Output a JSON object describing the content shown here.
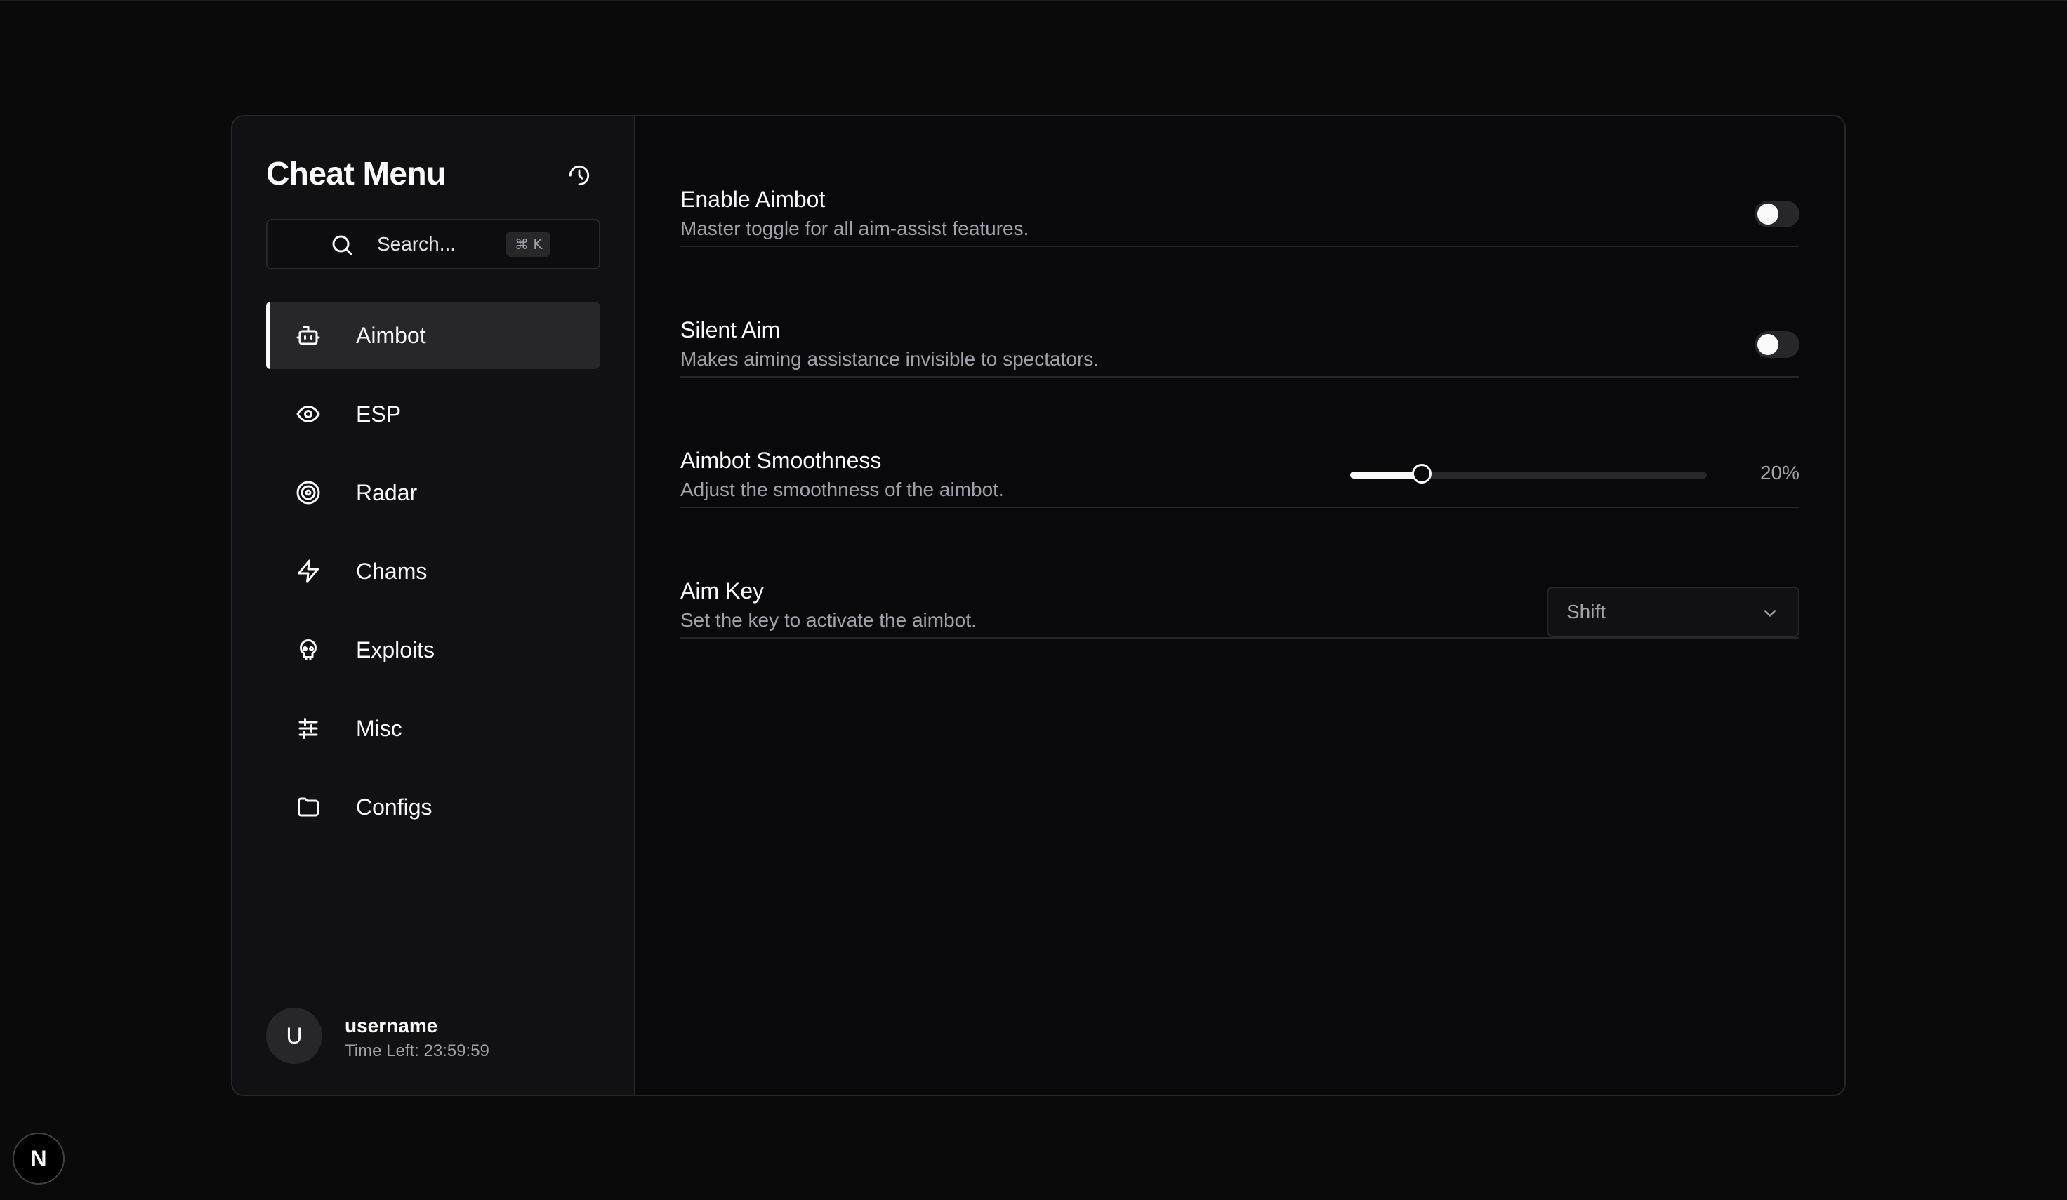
{
  "sidebar": {
    "title": "Cheat Menu",
    "search": {
      "placeholder": "Search...",
      "shortcut": "⌘ K"
    },
    "items": [
      {
        "label": "Aimbot",
        "icon": "bot-icon",
        "active": true
      },
      {
        "label": "ESP",
        "icon": "eye-icon",
        "active": false
      },
      {
        "label": "Radar",
        "icon": "target-icon",
        "active": false
      },
      {
        "label": "Chams",
        "icon": "zap-icon",
        "active": false
      },
      {
        "label": "Exploits",
        "icon": "skull-icon",
        "active": false
      },
      {
        "label": "Misc",
        "icon": "sliders-icon",
        "active": false
      },
      {
        "label": "Configs",
        "icon": "folder-icon",
        "active": false
      }
    ],
    "user": {
      "avatar_initial": "U",
      "username": "username",
      "time_left": "Time Left: 23:59:59"
    }
  },
  "settings": {
    "enable_aimbot": {
      "title": "Enable Aimbot",
      "description": "Master toggle for all aim-assist features.",
      "enabled": false
    },
    "silent_aim": {
      "title": "Silent Aim",
      "description": "Makes aiming assistance invisible to spectators.",
      "enabled": false
    },
    "smoothness": {
      "title": "Aimbot Smoothness",
      "description": "Adjust the smoothness of the aimbot.",
      "value": 20,
      "value_label": "20%"
    },
    "aim_key": {
      "title": "Aim Key",
      "description": "Set the key to activate the aimbot.",
      "selected": "Shift"
    }
  },
  "badge": {
    "label": "N"
  },
  "colors": {
    "background": "#0a0a0b",
    "panel": "#111113",
    "border": "#27272a",
    "text": "#fafafa",
    "muted": "#a1a1aa"
  }
}
